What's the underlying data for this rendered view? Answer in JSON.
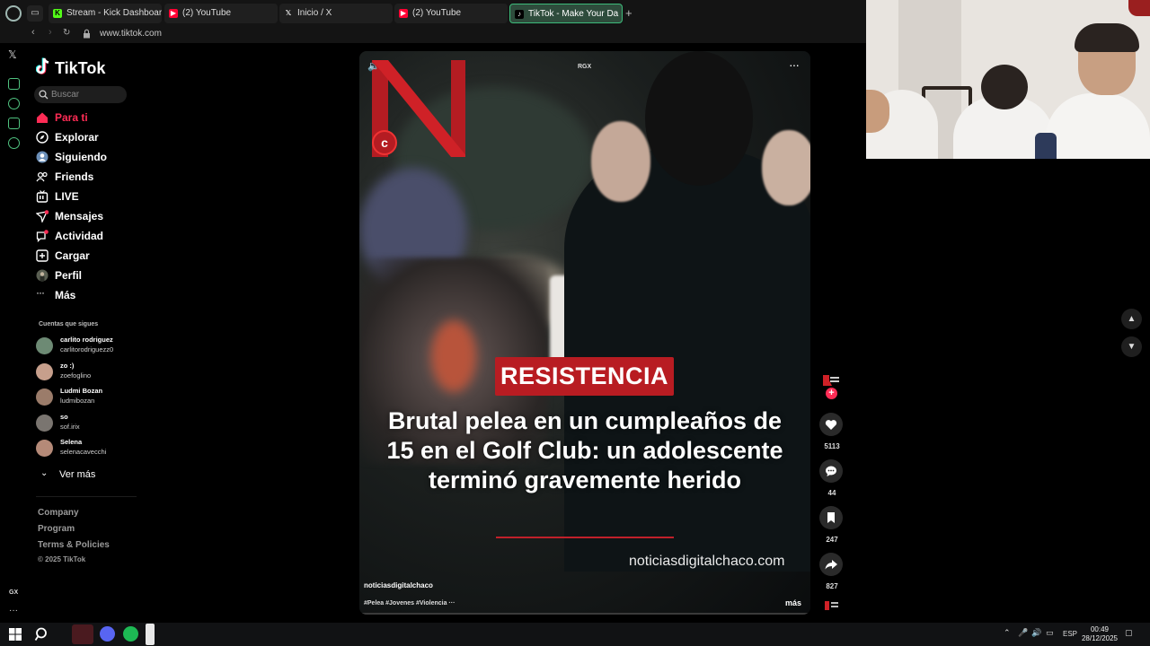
{
  "browser": {
    "tabs": [
      {
        "label": "Stream - Kick Dashboard",
        "icon": "kick-icon"
      },
      {
        "label": "(2) YouTube",
        "icon": "youtube-icon"
      },
      {
        "label": "Inicio / X",
        "icon": "x-icon"
      },
      {
        "label": "(2) YouTube",
        "icon": "youtube-icon"
      },
      {
        "label": "TikTok - Make Your Da",
        "icon": "tiktok-icon",
        "active": true
      }
    ],
    "url": "www.tiktok.com",
    "accent_color": "#3dbb7a"
  },
  "opera_sidebar": {
    "bottom_label": "GX"
  },
  "tiktok": {
    "logo_text": "TikTok",
    "search_placeholder": "Buscar",
    "nav": [
      {
        "label": "Para ti",
        "icon": "home-icon",
        "active": true
      },
      {
        "label": "Explorar",
        "icon": "compass-icon"
      },
      {
        "label": "Siguiendo",
        "icon": "following-icon"
      },
      {
        "label": "Friends",
        "icon": "friends-icon"
      },
      {
        "label": "LIVE",
        "icon": "live-icon"
      },
      {
        "label": "Mensajes",
        "icon": "messages-icon"
      },
      {
        "label": "Actividad",
        "icon": "activity-icon"
      },
      {
        "label": "Cargar",
        "icon": "upload-icon"
      },
      {
        "label": "Perfil",
        "icon": "profile-icon"
      },
      {
        "label": "Más",
        "icon": "more-icon"
      }
    ],
    "following_title": "Cuentas que sigues",
    "following": [
      {
        "name": "carlito rodriguez",
        "handle": "carlitorodriguezz0",
        "color": "#6d8a74"
      },
      {
        "name": "zo :)",
        "handle": "zoefoglino",
        "color": "#c79f8c"
      },
      {
        "name": "Ludmi Bozan",
        "handle": "ludmibozan",
        "color": "#9b7c6a"
      },
      {
        "name": "so",
        "handle": "sof.irix",
        "color": "#7a7570"
      },
      {
        "name": "Selena",
        "handle": "selenacavecchi",
        "color": "#b58a78"
      }
    ],
    "ver_mas": "Ver más",
    "footer": [
      "Company",
      "Program",
      "Terms & Policies"
    ],
    "copyright": "© 2025 TikTok",
    "brand_color": "#fe2c55"
  },
  "video": {
    "channel_top": "RGX",
    "badge": "RESISTENCIA",
    "headline": "Brutal pelea en un cumpleaños de 15 en el Golf Club: un adolescente terminó gravemente herido",
    "site": "noticiasdigitalchaco.com",
    "author": "noticiasdigitalchaco",
    "tags": "#Pelea #Jovenes #Violencia ···",
    "more_label": "más",
    "progress": 0.0,
    "likes": "5113",
    "comments": "44",
    "saves": "247",
    "shares": "827"
  },
  "taskbar": {
    "lang": "ESP",
    "time": "00:49",
    "date": "28/12/2025"
  }
}
